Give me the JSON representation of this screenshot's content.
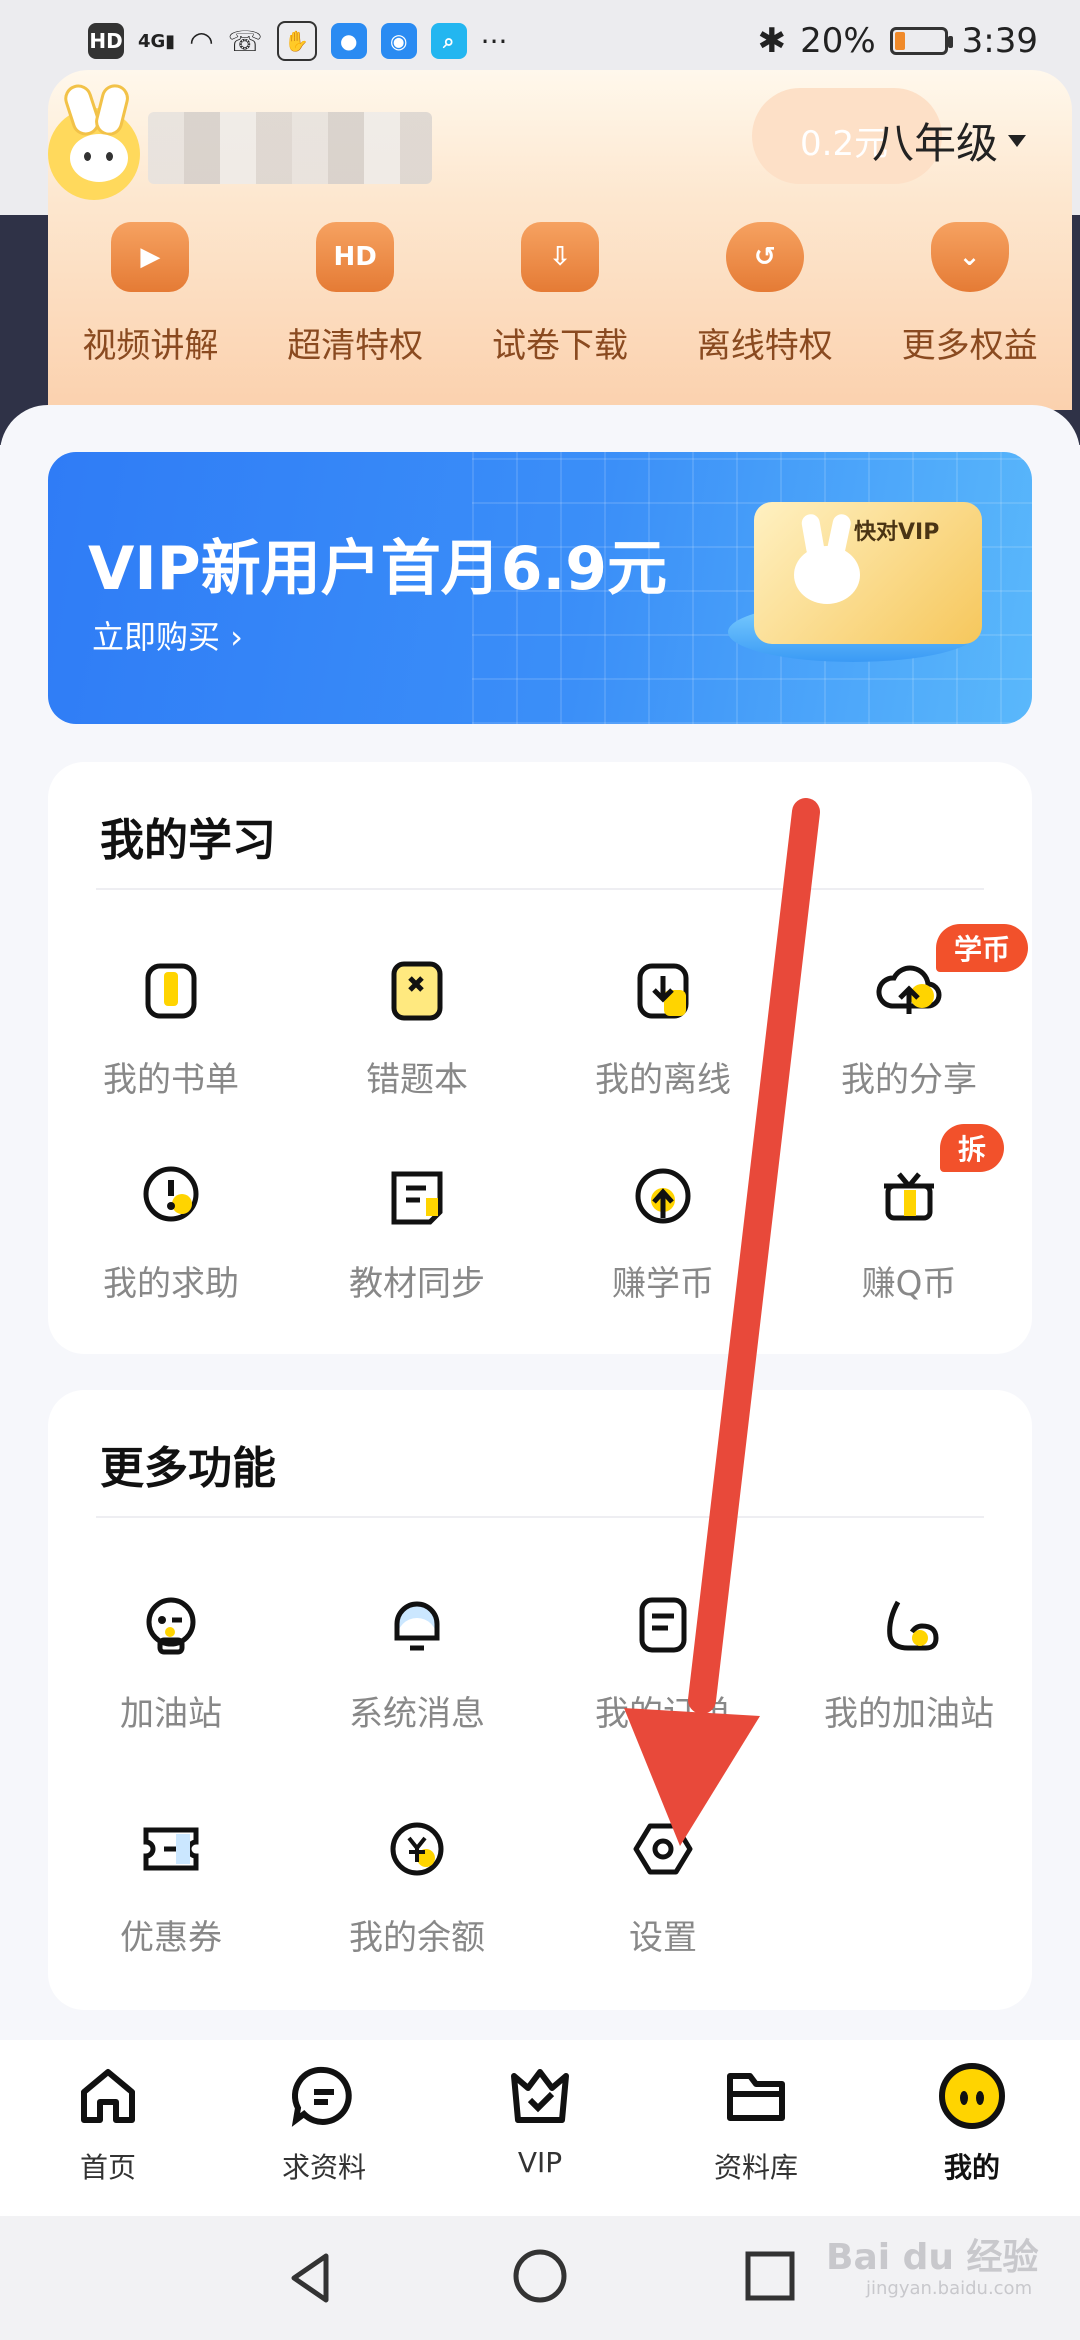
{
  "status_bar": {
    "left_chips": [
      "HD",
      "4G",
      "wifi",
      "missed-call",
      "hand",
      "app1",
      "bulb",
      "search",
      "···"
    ],
    "battery_percent": "20%",
    "battery_level": 0.2,
    "time": "3:39"
  },
  "header": {
    "coins": "0.2元",
    "grade": "八年级"
  },
  "perks": [
    {
      "label": "视频讲解",
      "icon": "video-icon"
    },
    {
      "label": "超清特权",
      "icon": "hd-icon"
    },
    {
      "label": "试卷下载",
      "icon": "download-icon"
    },
    {
      "label": "离线特权",
      "icon": "cloud-icon"
    },
    {
      "label": "更多权益",
      "icon": "heart-down-icon"
    }
  ],
  "banner": {
    "title": "VIP新用户首月6.9元",
    "subtitle": "立即购买 ›",
    "card_text": "快对VIP"
  },
  "my_study": {
    "title": "我的学习",
    "items": [
      {
        "label": "我的书单",
        "icon": "book-icon"
      },
      {
        "label": "错题本",
        "icon": "error-book-icon"
      },
      {
        "label": "我的离线",
        "icon": "offline-download-icon"
      },
      {
        "label": "我的分享",
        "icon": "upload-cloud-icon",
        "badge": "学币"
      },
      {
        "label": "我的求助",
        "icon": "help-icon"
      },
      {
        "label": "教材同步",
        "icon": "textbook-icon"
      },
      {
        "label": "赚学币",
        "icon": "earn-coin-icon"
      },
      {
        "label": "赚Q币",
        "icon": "gift-icon",
        "badge": "拆"
      }
    ]
  },
  "more_features": {
    "title": "更多功能",
    "items": [
      {
        "label": "加油站",
        "icon": "station-face-icon"
      },
      {
        "label": "系统消息",
        "icon": "bell-icon"
      },
      {
        "label": "我的订单",
        "icon": "order-icon"
      },
      {
        "label": "我的加油站",
        "icon": "muscle-icon"
      },
      {
        "label": "优惠券",
        "icon": "coupon-icon"
      },
      {
        "label": "我的余额",
        "icon": "yuan-icon"
      },
      {
        "label": "设置",
        "icon": "settings-icon"
      }
    ]
  },
  "bottom_nav": [
    {
      "label": "首页",
      "icon": "home-icon"
    },
    {
      "label": "求资料",
      "icon": "chat-icon"
    },
    {
      "label": "VIP",
      "icon": "crown-icon"
    },
    {
      "label": "资料库",
      "icon": "folder-icon"
    },
    {
      "label": "我的",
      "icon": "avatar-face-icon",
      "active": true
    }
  ],
  "watermark": {
    "text": "Bai du 经验",
    "sub": "jingyan.baidu.com"
  },
  "colors": {
    "accent": "#f2512b",
    "annotation_arrow": "#e8493a",
    "brand_yellow": "#ffd400"
  }
}
